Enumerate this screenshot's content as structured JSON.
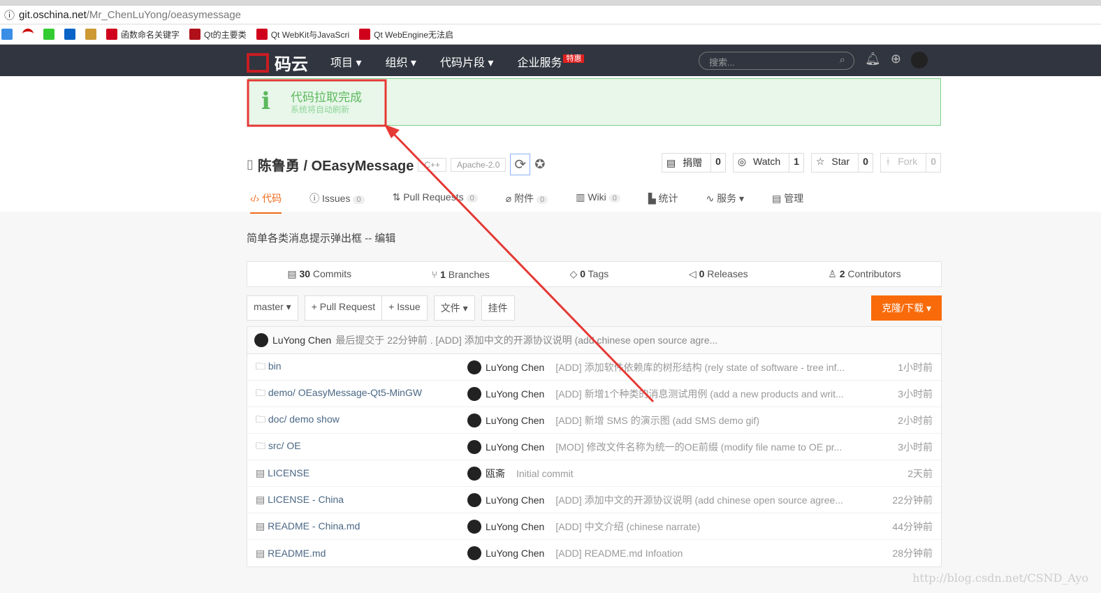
{
  "browser": {
    "url_host": "git.oschina.net",
    "url_path": "/Mr_ChenLuYong/oeasymessage",
    "bookmarks": [
      {
        "label": "函数命名关键字",
        "color": "#d0021b"
      },
      {
        "label": "Qt的主要类",
        "color": "#b0101a"
      },
      {
        "label": "Qt WebKit与JavaScri",
        "color": "#d0021b"
      },
      {
        "label": "Qt WebEngine无法启",
        "color": "#d0021b"
      }
    ]
  },
  "nav": {
    "logo": "码云",
    "menu": [
      "项目 ▾",
      "组织 ▾",
      "代码片段 ▾",
      "企业服务"
    ],
    "hot_badge": "特惠",
    "search_placeholder": "搜索..."
  },
  "alert": {
    "title": "代码拉取完成",
    "subtitle": "系统将自动刷新"
  },
  "repo": {
    "owner_name": "陈鲁勇 / OEasyMessage",
    "lang": "C++",
    "license": "Apache-2.0",
    "actions": [
      {
        "label": "捐赠",
        "count": "0"
      },
      {
        "label": "Watch",
        "count": "1"
      },
      {
        "label": "Star",
        "count": "0"
      },
      {
        "label": "Fork",
        "count": "0"
      }
    ]
  },
  "tabs": [
    {
      "label": "代码"
    },
    {
      "label": "Issues",
      "count": "0"
    },
    {
      "label": "Pull Requests",
      "count": "0"
    },
    {
      "label": "附件",
      "count": "0"
    },
    {
      "label": "Wiki",
      "count": "0"
    },
    {
      "label": "统计"
    },
    {
      "label": "服务 ▾"
    },
    {
      "label": "管理"
    }
  ],
  "description": "简单各类消息提示弹出框 -- 编辑",
  "stats": [
    {
      "n": "30",
      "label": "Commits"
    },
    {
      "n": "1",
      "label": "Branches"
    },
    {
      "n": "0",
      "label": "Tags"
    },
    {
      "n": "0",
      "label": "Releases"
    },
    {
      "n": "2",
      "label": "Contributors"
    }
  ],
  "toolbar": {
    "branch": "master ▾",
    "pr": "+ Pull Request",
    "issue": "+ Issue",
    "file": "文件 ▾",
    "widget": "挂件",
    "clone": "克隆/下载 ▾"
  },
  "last_commit": {
    "author": "LuYong Chen",
    "text": "最后提交于 22分钟前 . [ADD] 添加中文的开源协议说明 (add chinese open source agre..."
  },
  "files": [
    {
      "name": "bin",
      "type": "folder",
      "author": "LuYong Chen",
      "msg": "[ADD] 添加软件依赖库的树形结构 (rely state of software - tree inf...",
      "time": "1小时前"
    },
    {
      "name": "demo/ OEasyMessage-Qt5-MinGW",
      "type": "folder",
      "author": "LuYong Chen",
      "msg": "[ADD] 新增1个种类的消息测试用例 (add a new products and writ...",
      "time": "3小时前"
    },
    {
      "name": "doc/ demo show",
      "type": "folder",
      "author": "LuYong Chen",
      "msg": "[ADD] 新增 SMS 的演示图 (add SMS demo gif)",
      "time": "2小时前"
    },
    {
      "name": "src/ OE",
      "type": "folder",
      "author": "LuYong Chen",
      "msg": "[MOD] 修改文件名称为统一的OE前缀 (modify file name to OE pr...",
      "time": "3小时前"
    },
    {
      "name": "LICENSE",
      "type": "file",
      "author": "瓯斋",
      "msg": "Initial commit",
      "time": "2天前"
    },
    {
      "name": "LICENSE - China",
      "type": "file",
      "author": "LuYong Chen",
      "msg": "[ADD] 添加中文的开源协议说明 (add chinese open source agree...",
      "time": "22分钟前"
    },
    {
      "name": "README - China.md",
      "type": "file",
      "author": "LuYong Chen",
      "msg": "[ADD] 中文介绍 (chinese narrate)",
      "time": "44分钟前"
    },
    {
      "name": "README.md",
      "type": "file",
      "author": "LuYong Chen",
      "msg": "[ADD] README.md Infoation",
      "time": "28分钟前"
    }
  ],
  "watermark": "http://blog.csdn.net/CSND_Ayo"
}
